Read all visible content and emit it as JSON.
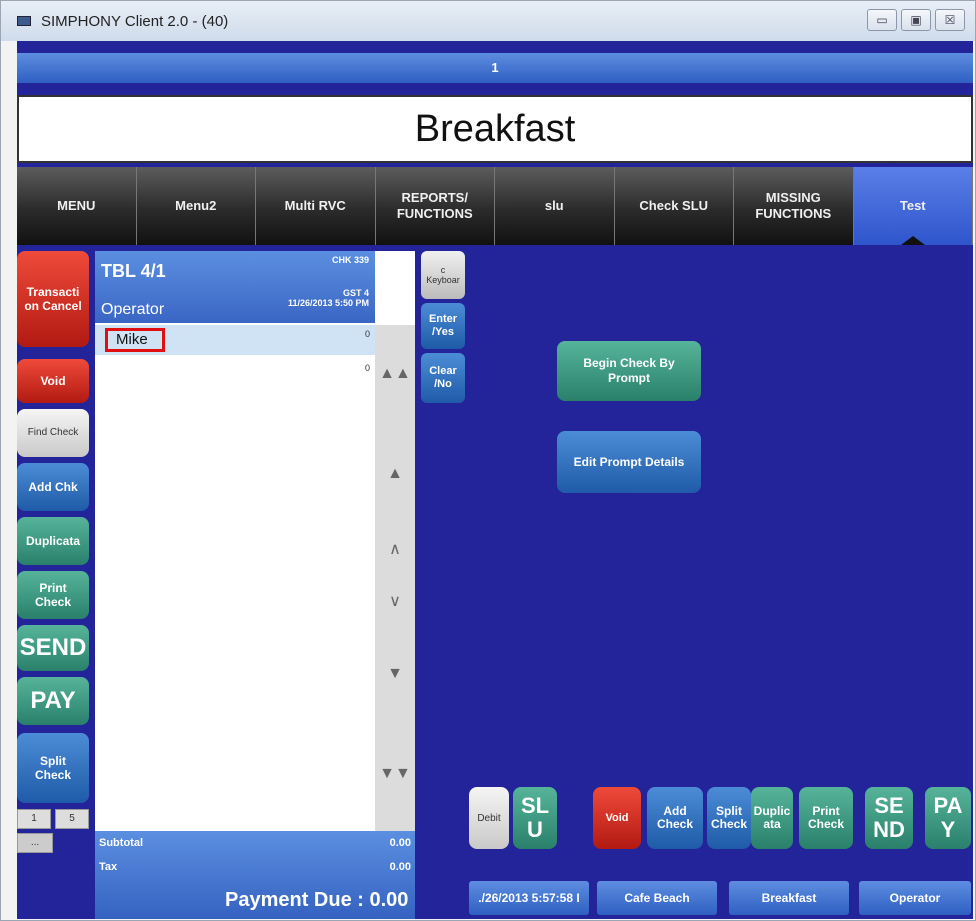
{
  "window": {
    "title": "SIMPHONY Client 2.0 - (40)",
    "min_icon": "minimize-icon",
    "max_icon": "maximize-icon",
    "close_icon": "close-icon",
    "min_glyph": "▭",
    "max_glyph": "▣",
    "close_glyph": "☒"
  },
  "page_indicator": "1",
  "banner_title": "Breakfast",
  "tabs": [
    "MENU",
    "Menu2",
    "Multi RVC",
    "REPORTS/\nFUNCTIONS",
    "slu",
    "Check SLU",
    "MISSING\nFUNCTIONS",
    "Test"
  ],
  "active_tab": "Test",
  "left_buttons": {
    "transaction_cancel": "Transacti\non Cancel",
    "void": "Void",
    "find_check": "Find Check",
    "add_chk": "Add Chk",
    "duplicata": "Duplicata",
    "print_check": "Print\nCheck",
    "send": "SEND",
    "pay": "PAY",
    "split_check": "Split\nCheck"
  },
  "pager": {
    "p1": "1",
    "p2": "5",
    "p3": "..."
  },
  "check": {
    "table": "TBL 4/1",
    "check_number": "CHK 339",
    "operator_label": "Operator",
    "guest": "GST 4",
    "datetime": "11/26/2013 5:50 PM",
    "items": [
      {
        "name": "Mike",
        "value": "0"
      }
    ],
    "second_value": "0"
  },
  "totals": {
    "subtotal_label": "Subtotal",
    "subtotal_value": "0.00",
    "tax_label": "Tax",
    "tax_value": "0.00",
    "payment_due_label": "Payment Due :",
    "payment_due_value": "0.00"
  },
  "side_keys": {
    "keyboard": "c\nKeyboar",
    "enter_yes": "Enter\n/Yes",
    "clear_no": "Clear\n/No"
  },
  "main_buttons": {
    "begin_check": "Begin Check By\nPrompt",
    "edit_prompt": "Edit Prompt Details"
  },
  "bottom_buttons": {
    "debit": "Debit",
    "slu": "SL\nU",
    "void": "Void",
    "add_check": "Add\nCheck",
    "split_check": "Split\nCheck",
    "duplicata": "Duplic\nata",
    "print_check": "Print\nCheck",
    "send": "SE\nND",
    "pay": "PA\nY"
  },
  "status_bar": {
    "datetime": "./26/2013 5:57:58 I",
    "location": "Cafe Beach",
    "period": "Breakfast",
    "operator": "Operator"
  },
  "colors": {
    "workspace": "#24249a",
    "accent_blue": "#3a66c4",
    "red": "#c0261b",
    "green": "#2f8a72",
    "highlight_red": "#e01010"
  }
}
